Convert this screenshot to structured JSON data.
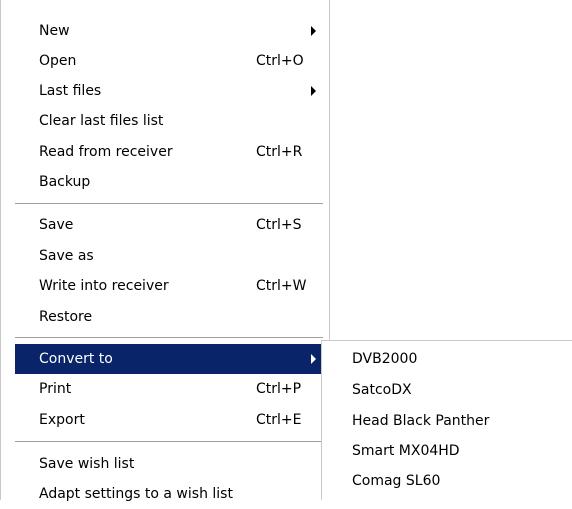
{
  "file_menu": {
    "items": [
      {
        "label": "New",
        "shortcut": "",
        "has_submenu": true
      },
      {
        "label": "Open",
        "shortcut": "Ctrl+O",
        "has_submenu": false
      },
      {
        "label": "Last files",
        "shortcut": "",
        "has_submenu": true
      },
      {
        "label": "Clear last files list",
        "shortcut": "",
        "has_submenu": false
      },
      {
        "label": "Read from receiver",
        "shortcut": "Ctrl+R",
        "has_submenu": false
      },
      {
        "label": "Backup",
        "shortcut": "",
        "has_submenu": false
      },
      {
        "label": "Save",
        "shortcut": "Ctrl+S",
        "has_submenu": false
      },
      {
        "label": "Save as",
        "shortcut": "",
        "has_submenu": false
      },
      {
        "label": "Write into receiver",
        "shortcut": "Ctrl+W",
        "has_submenu": false
      },
      {
        "label": "Restore",
        "shortcut": "",
        "has_submenu": false
      },
      {
        "label": "Convert to",
        "shortcut": "",
        "has_submenu": true,
        "highlighted": true
      },
      {
        "label": "Print",
        "shortcut": "Ctrl+P",
        "has_submenu": false
      },
      {
        "label": "Export",
        "shortcut": "Ctrl+E",
        "has_submenu": false
      },
      {
        "label": "Save wish list",
        "shortcut": "",
        "has_submenu": false
      },
      {
        "label": "Adapt settings to a wish list",
        "shortcut": "",
        "has_submenu": false
      }
    ]
  },
  "convert_submenu": {
    "items": [
      {
        "label": "DVB2000"
      },
      {
        "label": "SatcoDX"
      },
      {
        "label": "Head Black Panther"
      },
      {
        "label": "Smart MX04HD"
      },
      {
        "label": "Comag SL60"
      }
    ]
  },
  "colors": {
    "highlight_bg": "#0a246a",
    "highlight_fg": "#ffffff",
    "menu_bg": "#ffffff"
  }
}
